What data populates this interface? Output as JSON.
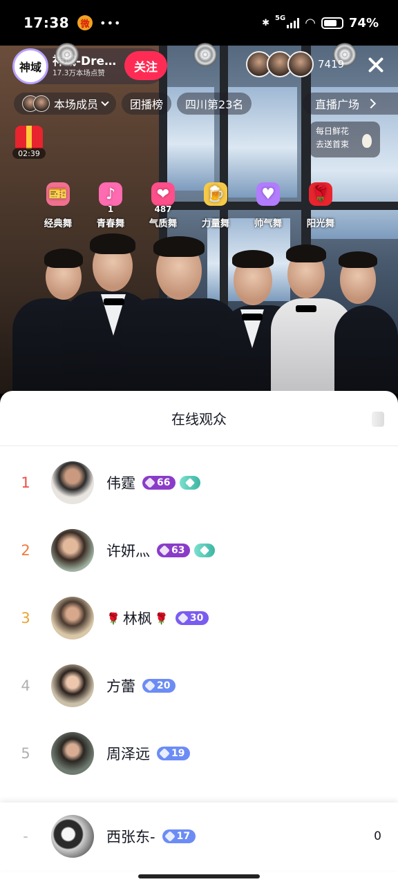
{
  "status": {
    "time": "17:38",
    "app_icon": "微",
    "network": "5G",
    "battery_pct": "74%",
    "battery_level": 0.74
  },
  "host": {
    "name": "神域-Dre…",
    "likes": "17.3万本场点赞",
    "avatar_text": "神域",
    "follow_label": "关注"
  },
  "viewer_count": "7419",
  "nav": {
    "members_label": "本场成员",
    "rank_label": "团播榜",
    "region_label": "四川第23名",
    "square_label": "直播广场"
  },
  "gift": {
    "timer": "02:39"
  },
  "flower_ad": {
    "line1": "每日鲜花",
    "line2": "去送首束"
  },
  "dances": [
    {
      "label": "经典舞",
      "count": "",
      "icon": "🎫",
      "color": "#f2708f"
    },
    {
      "label": "青春舞",
      "count": "1",
      "icon": "♪",
      "color": "#ff6bb0"
    },
    {
      "label": "气质舞",
      "count": "487",
      "icon": "❤",
      "color": "#ff4f8a"
    },
    {
      "label": "力量舞",
      "count": "",
      "icon": "🍺",
      "color": "#f7c948"
    },
    {
      "label": "帅气舞",
      "count": "",
      "icon": "♥",
      "color": "#b27cff"
    },
    {
      "label": "阳光舞",
      "count": "",
      "icon": "🌹",
      "color": "#e8242e"
    }
  ],
  "panel": {
    "title": "在线观众",
    "viewers": [
      {
        "rank": "1",
        "name": "伟霆",
        "level": "66",
        "fan_badge": true,
        "rank_color": "#f04a4a",
        "level_color": "#8a3cc9",
        "roses": false
      },
      {
        "rank": "2",
        "name": "许妍灬",
        "level": "63",
        "fan_badge": true,
        "rank_color": "#f07a3c",
        "level_color": "#8a3cc9",
        "roses": false
      },
      {
        "rank": "3",
        "name": "林枫",
        "level": "30",
        "fan_badge": false,
        "rank_color": "#e6a532",
        "level_color": "#7a5cf0",
        "roses": true
      },
      {
        "rank": "4",
        "name": "方蕾",
        "level": "20",
        "fan_badge": false,
        "rank_color": "#b0b0b0",
        "level_color": "#6c8cf5",
        "roses": false
      },
      {
        "rank": "5",
        "name": "周泽远",
        "level": "19",
        "fan_badge": false,
        "rank_color": "#b0b0b0",
        "level_color": "#6c8cf5",
        "roses": false
      }
    ],
    "me": {
      "rank": "-",
      "name": "西张东-",
      "level": "17",
      "score": "0",
      "level_color": "#6c8cf5"
    }
  },
  "rose_glyph": "🌹"
}
